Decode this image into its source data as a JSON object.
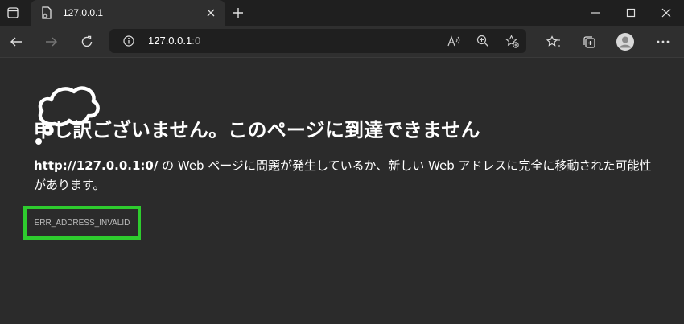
{
  "window": {
    "tab_title": "127.0.0.1",
    "new_tab_label": "+",
    "minimize": "—",
    "maximize": "☐",
    "close": "✕"
  },
  "address_bar": {
    "host": "127.0.0.1",
    "port": ":0"
  },
  "error_page": {
    "heading": "申し訳ございません。このページに到達できません",
    "url_bold": "http://127.0.0.1:0/",
    "description": " の Web ページに問題が発生しているか、新しい Web アドレスに完全に移動された可能性があります。",
    "error_code": "ERR_ADDRESS_INVALID"
  },
  "colors": {
    "background": "#2b2b2b",
    "highlight": "#2ecc2e"
  }
}
